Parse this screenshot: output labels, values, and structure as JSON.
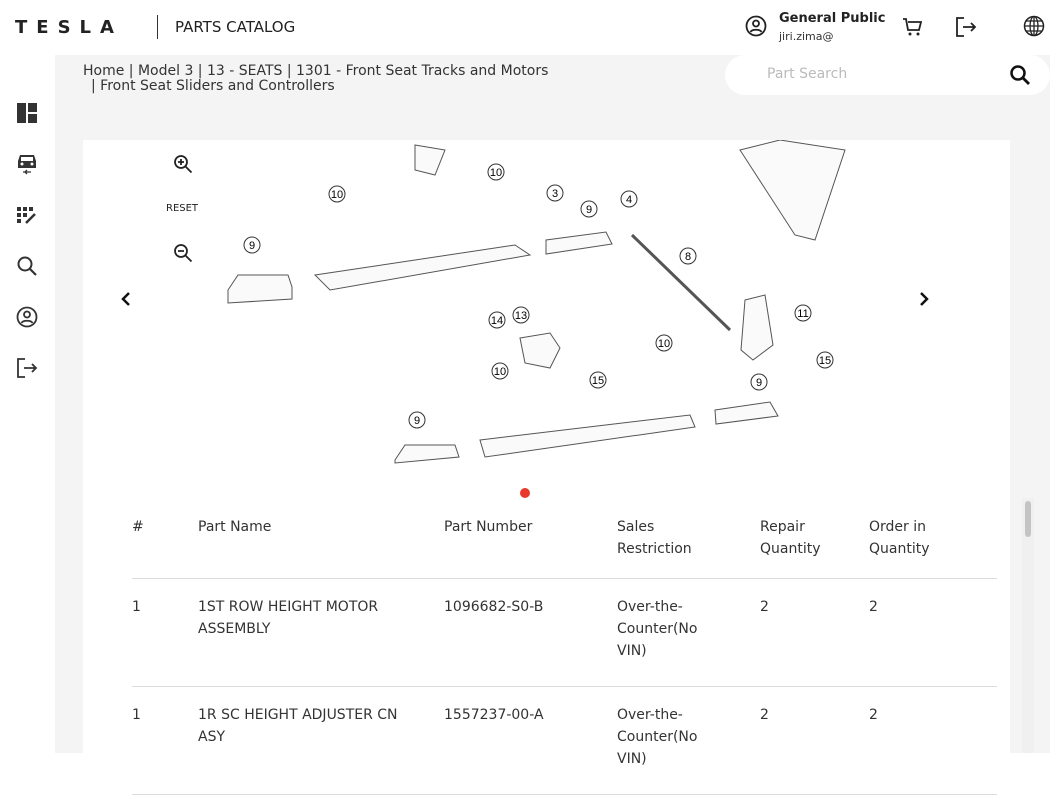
{
  "header": {
    "logo": "TESLA",
    "title": "PARTS CATALOG",
    "user_name": "General Public",
    "user_email": "jiri.zima@"
  },
  "breadcrumb": {
    "line1": "Home | Model 3 | 13 - SEATS | 1301 - Front Seat Tracks and Motors",
    "line2": "| Front Seat Sliders and Controllers"
  },
  "search": {
    "placeholder": "Part Search",
    "value": ""
  },
  "sidebar": {
    "icons": [
      "dashboard-icon",
      "car-icon",
      "catalog-grid-icon",
      "search-icon",
      "account-icon",
      "logout-icon"
    ]
  },
  "viewer": {
    "reset_label": "RESET",
    "active_slide": 1,
    "accent": "#e8382d",
    "callouts": [
      "10",
      "10",
      "3",
      "9",
      "4",
      "9",
      "8",
      "11",
      "14",
      "13",
      "10",
      "10",
      "15",
      "15",
      "9",
      "9"
    ]
  },
  "table": {
    "columns": [
      "#",
      "Part Name",
      "Part Number",
      "Sales Restriction",
      "Repair Quantity",
      "Order in Quantity"
    ],
    "rows": [
      {
        "num": "1",
        "name": "1ST ROW HEIGHT MOTOR ASSEMBLY",
        "number": "1096682-S0-B",
        "restriction": "Over-the-Counter(No VIN)",
        "repair": "2",
        "order": "2"
      },
      {
        "num": "1",
        "name": "1R SC HEIGHT ADJUSTER CN ASY",
        "number": "1557237-00-A",
        "restriction": "Over-the-Counter(No VIN)",
        "repair": "2",
        "order": "2"
      }
    ]
  }
}
